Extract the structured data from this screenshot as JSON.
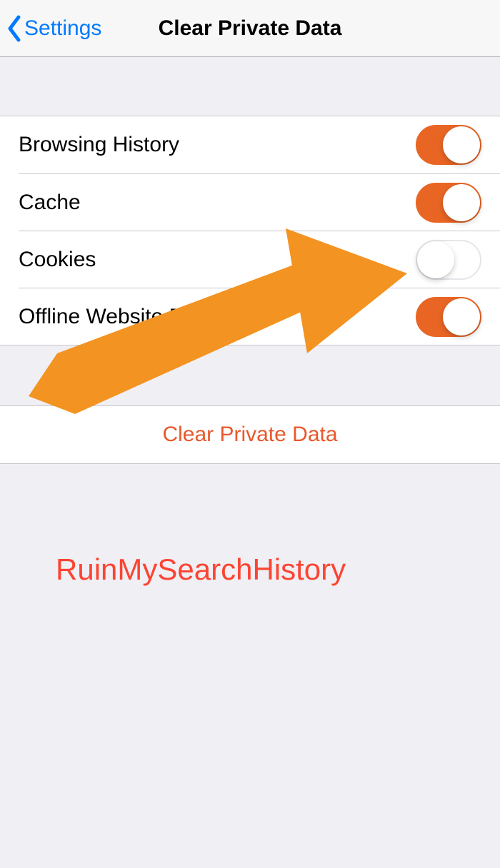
{
  "navbar": {
    "back_label": "Settings",
    "title": "Clear Private Data"
  },
  "toggles": [
    {
      "label": "Browsing History",
      "on": true
    },
    {
      "label": "Cache",
      "on": true
    },
    {
      "label": "Cookies",
      "on": false
    },
    {
      "label": "Offline Website Data",
      "on": true
    }
  ],
  "action": {
    "label": "Clear Private Data"
  },
  "watermark": "RuinMySearchHistory",
  "colors": {
    "link": "#007aff",
    "switch_on": "#e96524",
    "action_text": "#e9582b",
    "annotation": "#f39321",
    "watermark": "#fc4432"
  }
}
